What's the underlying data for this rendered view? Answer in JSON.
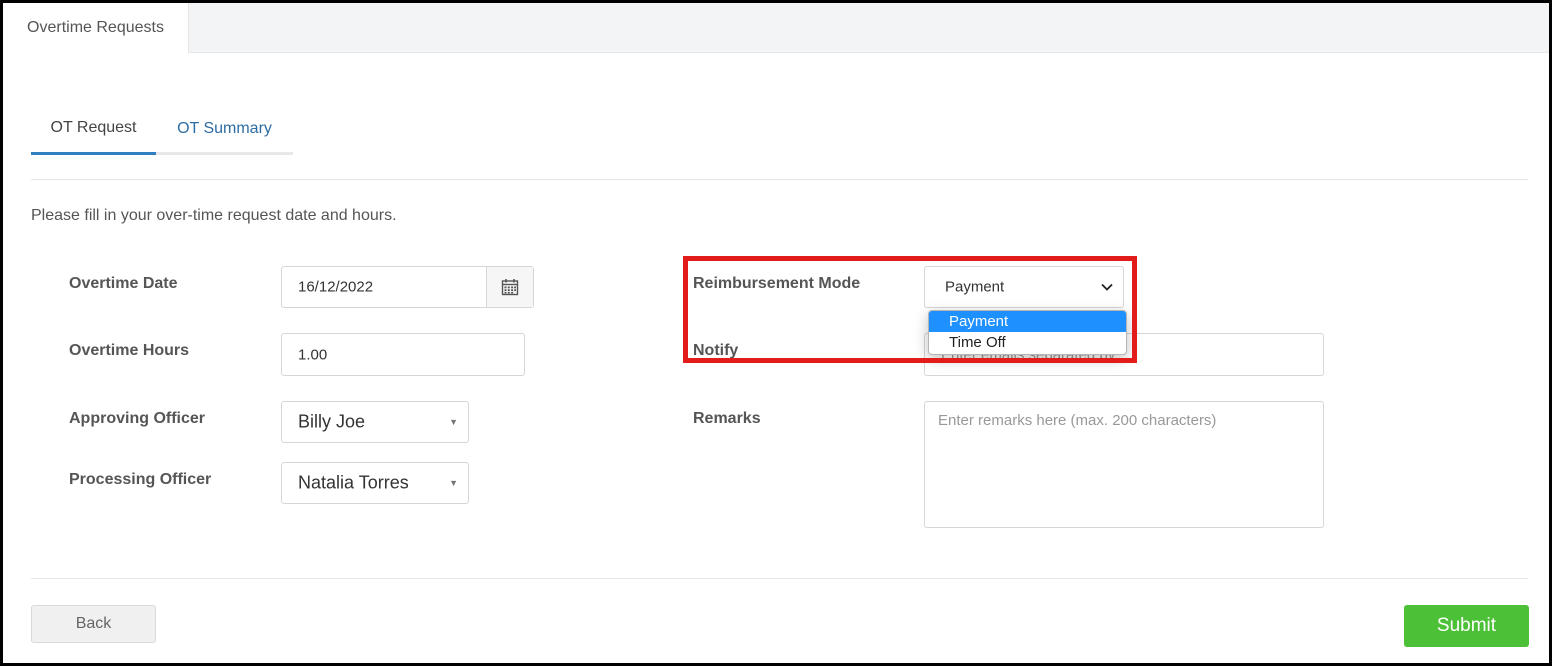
{
  "top_tab": {
    "label": "Overtime Requests"
  },
  "subtabs": [
    {
      "label": "OT Request",
      "active": true
    },
    {
      "label": "OT Summary",
      "active": false
    }
  ],
  "intro_text": "Please fill in your over-time request date and hours.",
  "form": {
    "overtime_date": {
      "label": "Overtime Date",
      "value": "16/12/2022",
      "icon": "calendar-icon"
    },
    "overtime_hours": {
      "label": "Overtime Hours",
      "value": "1.00"
    },
    "approving_officer": {
      "label": "Approving Officer",
      "value": "Billy Joe"
    },
    "processing_officer": {
      "label": "Processing Officer",
      "value": "Natalia Torres"
    },
    "reimbursement_mode": {
      "label": "Reimbursement Mode",
      "value": "Payment",
      "options": [
        "Payment",
        "Time Off"
      ],
      "selected_option": "Payment"
    },
    "notify": {
      "label": "Notify",
      "placeholder": "Enter emails separated by ;"
    },
    "remarks": {
      "label": "Remarks",
      "placeholder": "Enter remarks here (max. 200 characters)"
    }
  },
  "buttons": {
    "back": "Back",
    "submit": "Submit"
  },
  "colors": {
    "accent": "#2f7fc1",
    "link": "#2e6da4",
    "submit": "#4cc137",
    "highlight": "#e21b1b",
    "dropdown_selected": "#1e90ff"
  }
}
